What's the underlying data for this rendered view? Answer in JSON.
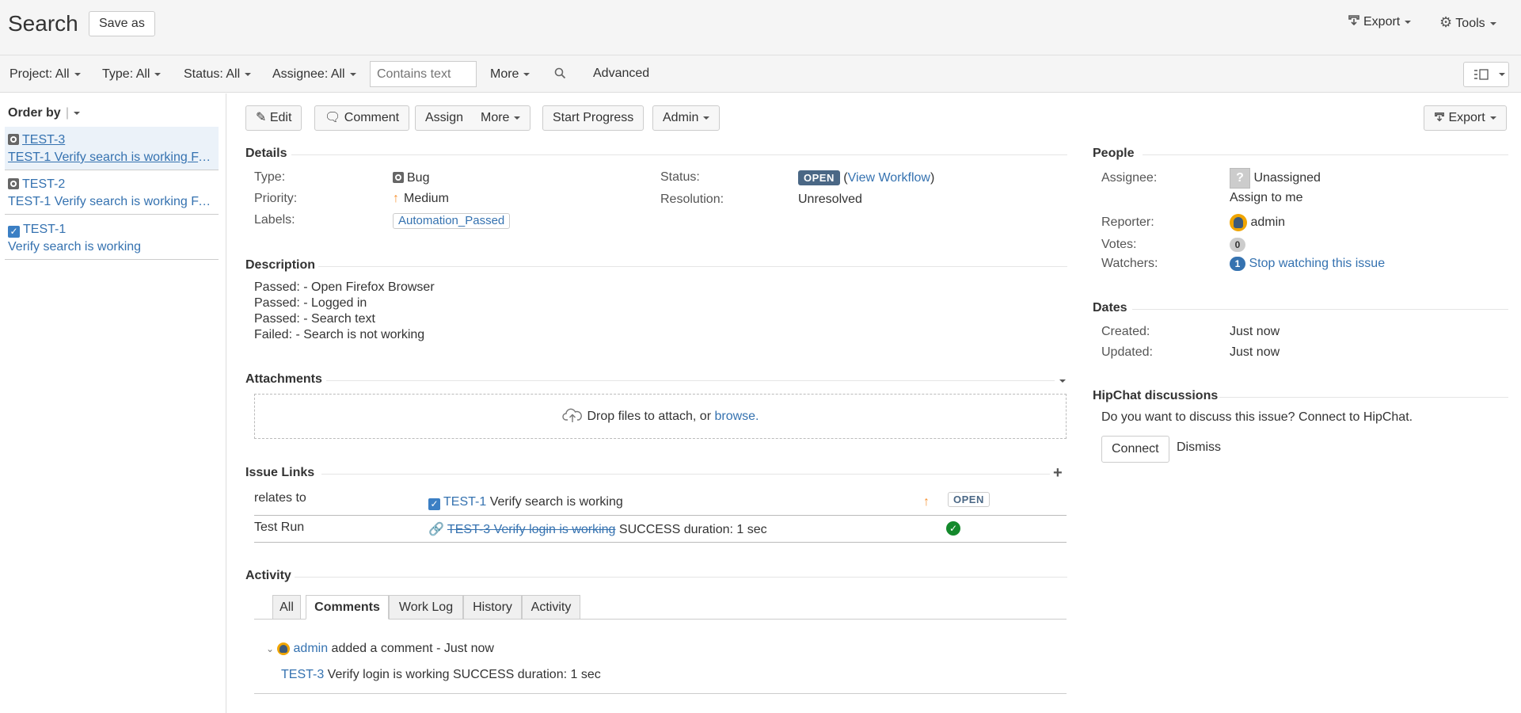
{
  "header": {
    "title": "Search",
    "save_as": "Save as",
    "export": "Export",
    "tools": "Tools"
  },
  "filters": {
    "project": "Project: All",
    "type": "Type: All",
    "status": "Status: All",
    "assignee": "Assignee: All",
    "text_placeholder": "Contains text",
    "more": "More",
    "advanced": "Advanced"
  },
  "sidebar": {
    "order_by": "Order by",
    "items": [
      {
        "key": "TEST-3",
        "summary": "TEST-1 Verify search is working FA…",
        "type": "bug"
      },
      {
        "key": "TEST-2",
        "summary": "TEST-1 Verify search is working FA…",
        "type": "bug"
      },
      {
        "key": "TEST-1",
        "summary": "Verify search is working",
        "type": "task"
      }
    ]
  },
  "toolbar": {
    "edit": "Edit",
    "comment": "Comment",
    "assign": "Assign",
    "more": "More",
    "start_progress": "Start Progress",
    "admin": "Admin",
    "export": "Export"
  },
  "details": {
    "title": "Details",
    "type_label": "Type:",
    "type_value": "Bug",
    "priority_label": "Priority:",
    "priority_value": "Medium",
    "labels_label": "Labels:",
    "labels_value": "Automation_Passed",
    "status_label": "Status:",
    "status_value": "OPEN",
    "view_workflow": "View Workflow",
    "resolution_label": "Resolution:",
    "resolution_value": "Unresolved"
  },
  "description": {
    "title": "Description",
    "lines": [
      "Passed: - Open Firefox Browser",
      "Passed: - Logged in",
      "Passed: - Search text",
      "Failed: - Search is not working"
    ]
  },
  "attachments": {
    "title": "Attachments",
    "drop_text": "Drop files to attach, or ",
    "browse": "browse."
  },
  "issue_links": {
    "title": "Issue Links",
    "rows": [
      {
        "relation": "relates to",
        "key": "TEST-1",
        "summary": "Verify search is working",
        "status": "OPEN"
      },
      {
        "relation": "Test Run",
        "link_text": "TEST-3 Verify login is working",
        "suffix": "SUCCESS duration: 1 sec"
      }
    ]
  },
  "activity": {
    "title": "Activity",
    "tabs": [
      "All",
      "Comments",
      "Work Log",
      "History",
      "Activity"
    ],
    "active_tab": "Comments",
    "comment": {
      "author": "admin",
      "action": " added a comment - Just now",
      "issue_key": "TEST-3",
      "body": " Verify login is working SUCCESS duration: 1 sec"
    }
  },
  "people": {
    "title": "People",
    "assignee_label": "Assignee:",
    "assignee_value": "Unassigned",
    "assign_to_me": "Assign to me",
    "reporter_label": "Reporter:",
    "reporter_value": "admin",
    "votes_label": "Votes:",
    "votes_count": "0",
    "watchers_label": "Watchers:",
    "watchers_count": "1",
    "stop_watching": "Stop watching this issue"
  },
  "dates": {
    "title": "Dates",
    "created_label": "Created:",
    "created_value": "Just now",
    "updated_label": "Updated:",
    "updated_value": "Just now"
  },
  "hipchat": {
    "title": "HipChat discussions",
    "text": "Do you want to discuss this issue? Connect to HipChat.",
    "connect": "Connect",
    "dismiss": "Dismiss"
  },
  "colors": {
    "link": "#3572b0",
    "lozenge": "#4a6785",
    "success": "#14892c",
    "priority_medium": "#f79232"
  }
}
